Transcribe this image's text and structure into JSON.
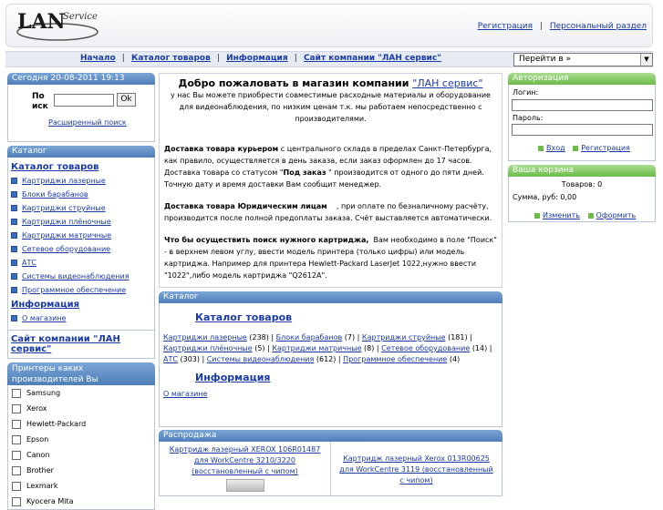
{
  "header": {
    "logo_text": "LAN Service",
    "links": [
      "Регистрация",
      "Персональный раздел"
    ],
    "separator": "|"
  },
  "nav": {
    "links": [
      "Начало",
      "Каталог товаров",
      "Информация",
      "Сайт компании \"ЛАН сервис\""
    ],
    "goto_label": "Перейти в »"
  },
  "left": {
    "date_header": "Сегодня 20-08-2011 19:13",
    "search_label": "Поиск",
    "ok_label": "Ok",
    "advanced_search": "Расширенный поиск",
    "catalog_header": "Каталог",
    "catalog_title": "Каталог товаров",
    "catalog_items": [
      "Картриджи лазерные",
      "Блоки барабанов",
      "Картриджи струйные",
      "Картриджи плёночные",
      "Картриджи матричные",
      "Сетевое оборудование",
      "АТС",
      "Системы видеонаблюдения",
      "Программное обеспечение"
    ],
    "info_title": "Информация",
    "info_item": "О магазине",
    "site_link": "Сайт компании \"ЛАН сервис\"",
    "printers_header": "Принтеры каких производителей Вы используете?",
    "printers": [
      "Samsung",
      "Xerox",
      "Hewlett-Packard",
      "Epson",
      "Canon",
      "Brother",
      "Lexmark",
      "Kyocera Mita"
    ]
  },
  "main": {
    "welcome_title": "Добро пожаловать в магазин компании ",
    "welcome_link": "\"ЛАН сервис\"",
    "welcome_sub": "у нас Вы можете приобрести совместимые расходные материалы и оборудование для видеонаблюдения, по низким ценам т.к. мы работаем непосредственно с производителями.",
    "p1_bold": "Доставка товара курьером",
    "p1_text": " с центрального склада в пределах Санкт-Петербурга, как правило, осуществляется в день заказа, если заказ оформлен до 17 часов. Доставка товара со статусом \"",
    "p1_bold2": "Под заказ",
    "p1_text2": " \" производится от одного до пяти дней. Точную дату и время доставки Вам сообщит менеджер.",
    "p2_bold": "Доставка товара Юридическим лицам",
    "p2_text": "    , при оплате по безналичному расчёту, производится после полной предоплаты заказа. Счёт выставляется автоматически.",
    "p3_bold": "Что бы осуществить поиск нужного картриджа,",
    "p3_text": "  Вам необходимо в поле \"Поиск\" - в верхнем левом углу, ввести модель принтера (только цифры) или модель картриджа. Например для принтера Hewlett-Packard LaserJet 1022,нужно ввести \"1022\",либо модель картриджа \"Q2612A\".",
    "catalog_header": "Каталог",
    "catalog_title": "Каталог товаров",
    "catalog_entries": [
      {
        "name": "Картриджи лазерные",
        "count": "(238)"
      },
      {
        "name": "Блоки барабанов",
        "count": "(7)"
      },
      {
        "name": "Картриджи струйные",
        "count": "(181)"
      },
      {
        "name": "Картриджи плёночные",
        "count": "(5)"
      },
      {
        "name": "Картриджи матричные",
        "count": "(8)"
      },
      {
        "name": "Сетевое оборудование",
        "count": "(14)"
      },
      {
        "name": "АТС",
        "count": "(303)"
      },
      {
        "name": "Системы видеонаблюдения",
        "count": "(612)"
      },
      {
        "name": "Программное обеспечение",
        "count": "(4)"
      }
    ],
    "info_title": "Информация",
    "info_link": "О магазине",
    "sale_header": "Распродажа",
    "sale_items": [
      "Картридж лазерный XEROX 106R01487 для WorkCentre 3210/3220 (восстановленный с чипом)",
      "Картридж лазерный Xerox 013R00625 для WorkCentre 3119 (восстановленный с чипом)"
    ]
  },
  "right": {
    "auth_header": "Авторизация",
    "login_label": "Логин:",
    "password_label": "Пароль:",
    "enter_link": "Вход",
    "register_link": "Регистрация",
    "cart_header": "Ваша корзина",
    "items_text": "Товаров: 0",
    "sum_text": "Сумма, руб: 0,00",
    "edit_link": "Изменить",
    "checkout_link": "Оформить"
  },
  "colors": {
    "blue_header": "#5b87c0",
    "green_header": "#7cc55a",
    "link": "#1a3aa6"
  }
}
